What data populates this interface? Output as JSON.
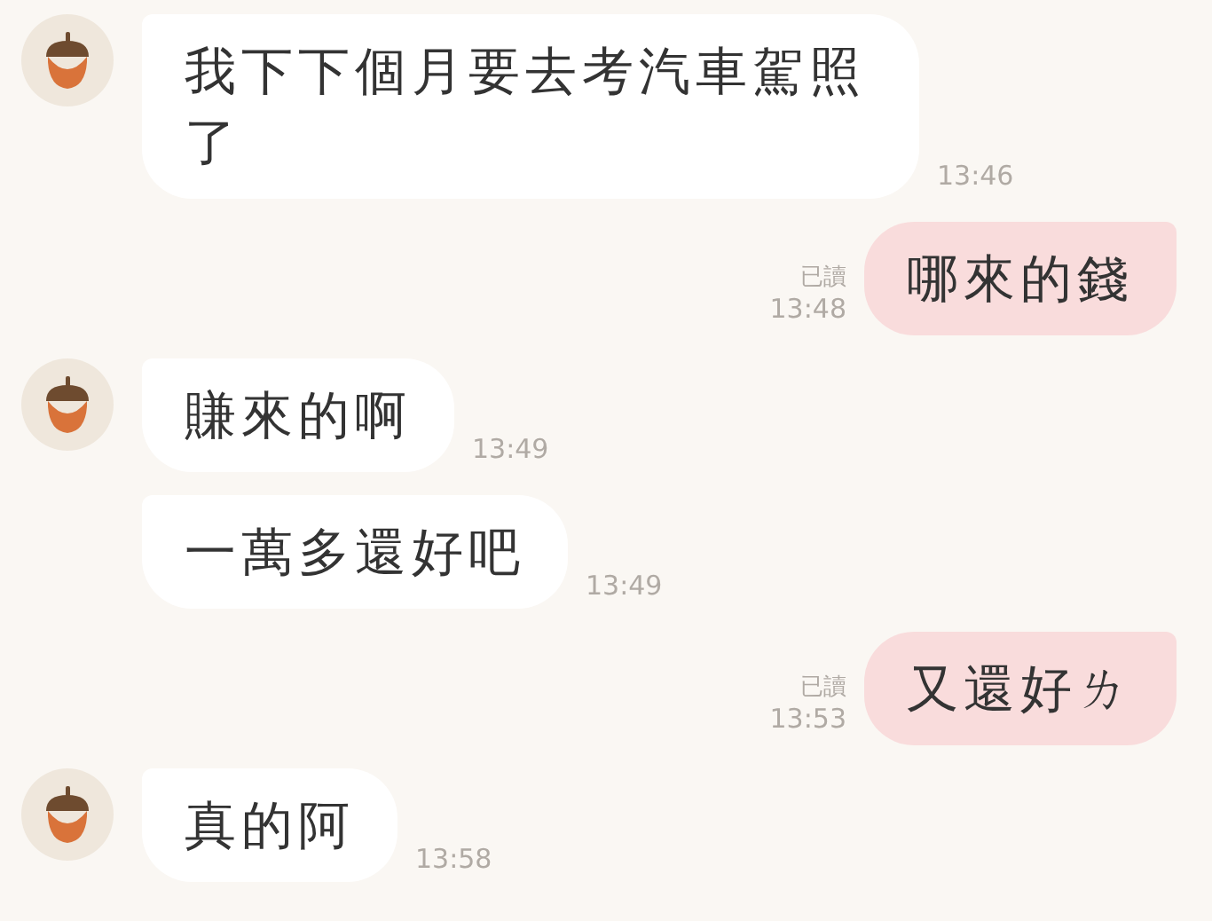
{
  "messages": [
    {
      "kind": "in",
      "avatar": true,
      "text": "我下下個月要去考汽車駕照了",
      "time": "13:46"
    },
    {
      "kind": "out",
      "text": "哪來的錢",
      "read_label": "已讀",
      "time": "13:48"
    },
    {
      "kind": "in",
      "avatar": true,
      "text": "賺來的啊",
      "time": "13:49"
    },
    {
      "kind": "in",
      "avatar": false,
      "text": "一萬多還好吧",
      "time": "13:49"
    },
    {
      "kind": "out",
      "text": "又還好ㄌ",
      "read_label": "已讀",
      "time": "13:53"
    },
    {
      "kind": "in",
      "avatar": true,
      "text": "真的阿",
      "time": "13:58"
    }
  ]
}
